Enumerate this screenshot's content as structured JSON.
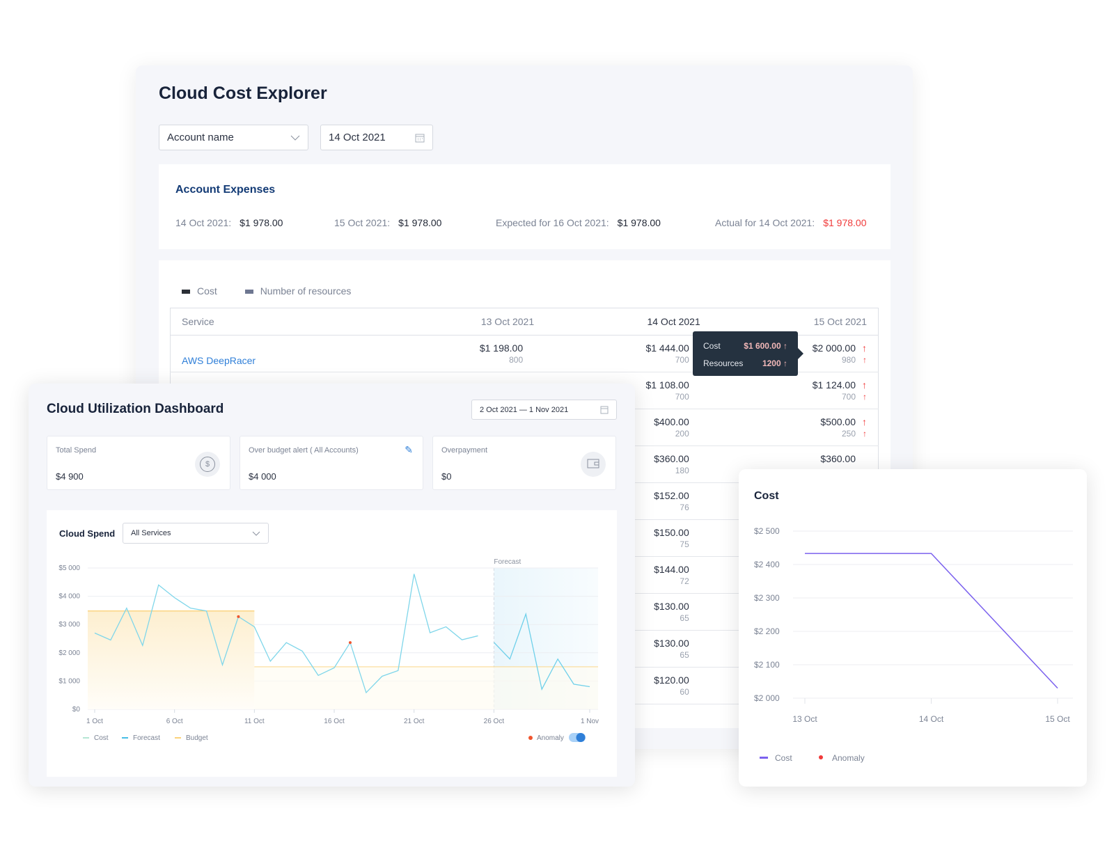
{
  "explorer": {
    "title": "Cloud Cost Explorer",
    "account_select": "Account name",
    "date_input": "14 Oct 2021",
    "expenses": {
      "title": "Account Expenses",
      "items": [
        {
          "label": "14 Oct 2021:",
          "value": "$1 978.00"
        },
        {
          "label": "15 Oct 2021:",
          "value": "$1 978.00"
        },
        {
          "label": "Expected for 16 Oct 2021:",
          "value": "$1 978.00"
        },
        {
          "label": "Actual for 14 Oct 2021:",
          "value": "$1 978.00",
          "color": "#f03a3a"
        }
      ]
    },
    "legend": [
      {
        "label": "Cost",
        "color": "#2b2f36"
      },
      {
        "label": "Number of resources",
        "color": "#6e7791"
      }
    ],
    "table": {
      "columns": [
        "Service",
        "13 Oct 2021",
        "14 Oct 2021",
        "15 Oct 2021"
      ],
      "rows": [
        {
          "service": "AWS DeepRacer",
          "d13": [
            "$1 198.00",
            "800"
          ],
          "d14": [
            "$1 444.00",
            "700"
          ],
          "d15": [
            "$2 000.00",
            "980"
          ],
          "up15": true
        },
        {
          "service": "",
          "d13": [
            "",
            ""
          ],
          "d14": [
            "$1 108.00",
            "700"
          ],
          "d15": [
            "$1 124.00",
            "700"
          ],
          "up15": true
        },
        {
          "service": "",
          "d13": [
            "",
            ""
          ],
          "d14": [
            "$400.00",
            "200"
          ],
          "d15": [
            "$500.00",
            "250"
          ],
          "up15": true
        },
        {
          "service": "",
          "d13": [
            "",
            ""
          ],
          "d14": [
            "$360.00",
            "180"
          ],
          "d15": [
            "$360.00",
            ""
          ],
          "up15": false
        },
        {
          "service": "",
          "d13": [
            "",
            ""
          ],
          "d14": [
            "$152.00",
            "76"
          ],
          "d15": [
            "",
            ""
          ],
          "up15": false
        },
        {
          "service": "",
          "d13": [
            "",
            ""
          ],
          "d14": [
            "$150.00",
            "75"
          ],
          "d15": [
            "",
            ""
          ],
          "up15": false
        },
        {
          "service": "",
          "d13": [
            "",
            ""
          ],
          "d14": [
            "$144.00",
            "72"
          ],
          "d15": [
            "",
            ""
          ],
          "up15": false
        },
        {
          "service": "",
          "d13": [
            "",
            ""
          ],
          "d14": [
            "$130.00",
            "65"
          ],
          "d15": [
            "",
            ""
          ],
          "up15": false
        },
        {
          "service": "",
          "d13": [
            "",
            ""
          ],
          "d14": [
            "$130.00",
            "65"
          ],
          "d15": [
            "",
            ""
          ],
          "up15": false
        },
        {
          "service": "",
          "d13": [
            "",
            ""
          ],
          "d14": [
            "$120.00",
            "60"
          ],
          "d15": [
            "",
            ""
          ],
          "up15": false
        }
      ]
    },
    "tooltip": {
      "cost_label": "Cost",
      "cost_value": "$1 600.00",
      "resources_label": "Resources",
      "resources_value": "1200"
    }
  },
  "utilization": {
    "title": "Cloud Utilization Dashboard",
    "date_range": "2 Oct 2021 — 1 Nov 2021",
    "kpis": [
      {
        "label": "Total Spend",
        "value": "$4 900",
        "icon": "dollar-coin-icon"
      },
      {
        "label": "Over budget alert ( All Accounts)",
        "value": "$4 000",
        "icon": "pencil-icon"
      },
      {
        "label": "Overpayment",
        "value": "$0",
        "icon": "wallet-icon"
      }
    ],
    "spend_title": "Cloud Spend",
    "service_select": "All Services",
    "anomaly_toggle": true
  },
  "chart_data": [
    {
      "type": "line",
      "title": "Cloud Spend",
      "x": [
        "1 Oct",
        "2 Oct",
        "3 Oct",
        "4 Oct",
        "5 Oct",
        "6 Oct",
        "7 Oct",
        "8 Oct",
        "9 Oct",
        "10 Oct",
        "11 Oct",
        "12 Oct",
        "13 Oct",
        "14 Oct",
        "15 Oct",
        "16 Oct",
        "17 Oct",
        "18 Oct",
        "19 Oct",
        "20 Oct",
        "21 Oct",
        "22 Oct",
        "23 Oct",
        "24 Oct",
        "25 Oct",
        "26 Oct",
        "27 Oct",
        "28 Oct",
        "29 Oct",
        "30 Oct",
        "31 Oct",
        "1 Nov"
      ],
      "x_ticks": [
        "1 Oct",
        "6 Oct",
        "11 Oct",
        "16 Oct",
        "21 Oct",
        "26 Oct",
        "1 Nov"
      ],
      "y_ticks": [
        "$0",
        "$1 000",
        "$2 000",
        "$3 000",
        "$4 000",
        "$5 000"
      ],
      "ylim": [
        0,
        5000
      ],
      "series": [
        {
          "name": "Cost",
          "color": "#7fd6ea",
          "values": [
            2700,
            2450,
            3580,
            2260,
            4400,
            3950,
            3580,
            3480,
            1570,
            3280,
            2920,
            1700,
            2360,
            2060,
            1200,
            1470,
            2360,
            590,
            1170,
            1370,
            4790,
            2710,
            2920,
            2460,
            2600,
            null,
            null,
            null,
            null,
            null,
            null,
            null
          ]
        },
        {
          "name": "Forecast",
          "color": "#6fd0ea",
          "values": [
            null,
            null,
            null,
            null,
            null,
            null,
            null,
            null,
            null,
            null,
            null,
            null,
            null,
            null,
            null,
            null,
            null,
            null,
            null,
            null,
            null,
            null,
            null,
            null,
            null,
            2370,
            1780,
            3370,
            710,
            1780,
            890,
            800
          ]
        },
        {
          "name": "Budget",
          "color": "#fbd27a",
          "values": [
            3480,
            3480,
            3480,
            3480,
            3480,
            3480,
            3480,
            3480,
            3480,
            3480,
            3480,
            1500,
            1500,
            1500,
            1500,
            1500,
            1500,
            1500,
            1500,
            1500,
            1500,
            1500,
            1500,
            1500,
            1500,
            1500,
            1500,
            1500,
            1500,
            1500,
            1500,
            1500
          ]
        }
      ],
      "anomalies": [
        {
          "x": "10 Oct",
          "y": 3280
        },
        {
          "x": "17 Oct",
          "y": 2360
        }
      ],
      "anomaly_label": "Anomaly",
      "anomaly_color": "#f0552e",
      "forecast_label": "Forecast",
      "forecast_start": "26 Oct",
      "grid": true,
      "legend": "bottom-left"
    },
    {
      "type": "line",
      "title": "Cost",
      "x": [
        "13 Oct",
        "14 Oct",
        "15 Oct"
      ],
      "y_ticks": [
        "$2 000",
        "$2 100",
        "$2 200",
        "$2 300",
        "$2 400",
        "$2 500"
      ],
      "ylim": [
        2000,
        2500
      ],
      "series": [
        {
          "name": "Cost",
          "color": "#7b61ee",
          "values": [
            2433,
            2433,
            2030
          ]
        }
      ],
      "anomaly_label": "Anomaly",
      "anomaly_color": "#f03a3a",
      "grid": true,
      "legend": "bottom-left"
    }
  ]
}
